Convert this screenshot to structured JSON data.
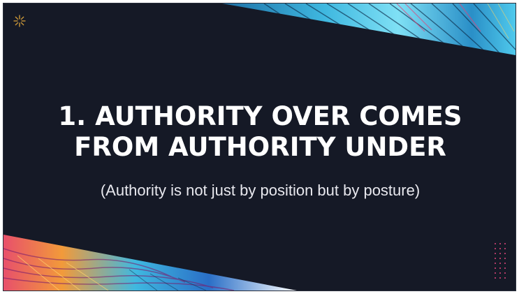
{
  "slide": {
    "title_line1": "1. AUTHORITY OVER COMES",
    "title_line2": "FROM AUTHORITY UNDER",
    "subtitle": "(Authority is not just by position but by posture)"
  },
  "icons": {
    "corner_top_left": "sun-icon",
    "corner_bottom_right": "dot-grid-icon"
  },
  "colors": {
    "background": "#151926",
    "title": "#ffffff",
    "accent_gold": "#d9a23a",
    "accent_pink": "#e0457b"
  }
}
